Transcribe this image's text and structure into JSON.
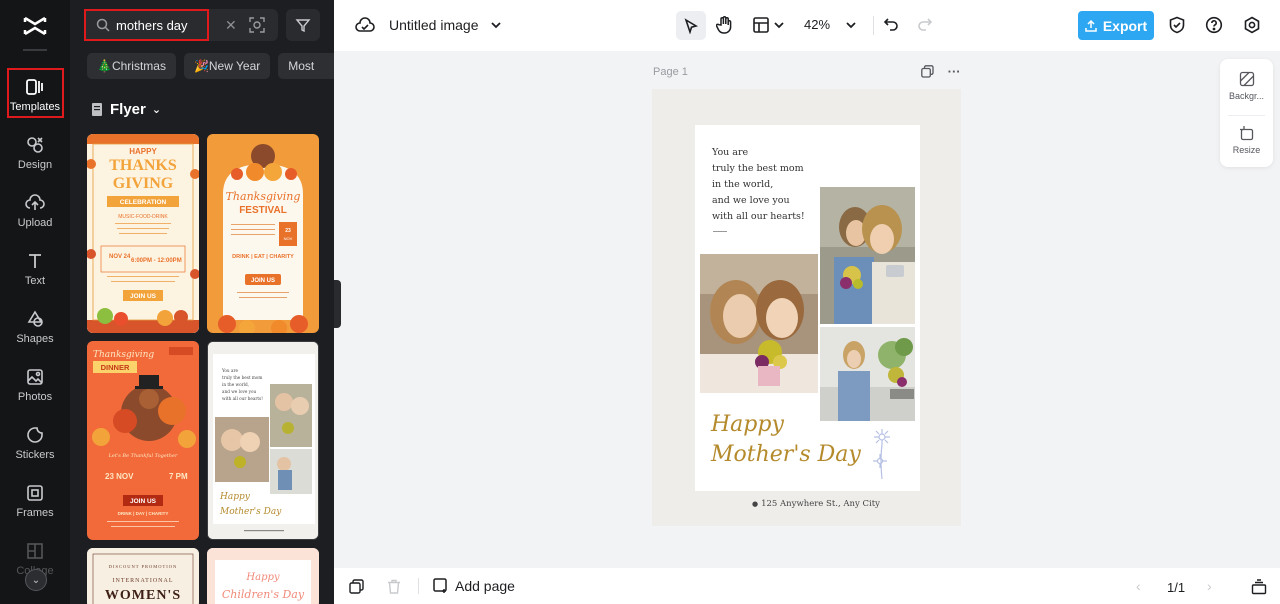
{
  "rail": {
    "items": [
      {
        "label": "Templates",
        "icon": "templates-icon"
      },
      {
        "label": "Design",
        "icon": "design-icon"
      },
      {
        "label": "Upload",
        "icon": "upload-icon"
      },
      {
        "label": "Text",
        "icon": "text-icon"
      },
      {
        "label": "Shapes",
        "icon": "shapes-icon"
      },
      {
        "label": "Photos",
        "icon": "photos-icon"
      },
      {
        "label": "Stickers",
        "icon": "stickers-icon"
      },
      {
        "label": "Frames",
        "icon": "frames-icon"
      },
      {
        "label": "Collage",
        "icon": "collage-icon"
      }
    ]
  },
  "panel": {
    "search": {
      "value": "mothers day"
    },
    "chips": [
      "🎄Christmas",
      "🎉New Year",
      "Most"
    ],
    "section_title": "Flyer",
    "thumbs": {
      "t1": {
        "line1": "HAPPY",
        "line2": "THANKS",
        "line3": "GIVING",
        "banner": "CELEBRATION",
        "sub": "MUSIC-FOOD-DRINK",
        "date": "NOV 24",
        "time": "6:00PM - 12:00PM",
        "cta": "JOIN US"
      },
      "t2": {
        "title": "Thanksgiving",
        "sub": "FESTIVAL",
        "date": "23 NOV 7PM",
        "tags": "DRINK | EAT | CHARITY",
        "cta": "JOIN US"
      },
      "t3": {
        "title": "Thanksgiving",
        "sub": "DINNER",
        "date": "23 NOV",
        "time": "7 PM",
        "cta": "JOIN US",
        "tags": "DRINK | DAY | CHARITY"
      },
      "t4": {
        "l1": "You are",
        "l2": "truly the best mom",
        "l3": "in the world,",
        "l4": "and we love you",
        "l5": "with all our hearts!",
        "hm1": "Happy",
        "hm2": "Mother's Day"
      },
      "t5": {
        "top": "DISCOUNT PROMOTION",
        "l1": "INTERNATIONAL",
        "l2": "WOMEN'S"
      },
      "t6": {
        "l1": "Happy",
        "l2": "Children's Day"
      }
    }
  },
  "topbar": {
    "title": "Untitled image",
    "zoom": "42%",
    "export_label": "Export",
    "accent": "#2ea7f2"
  },
  "canvas": {
    "page_label": "Page 1",
    "card": {
      "text": "You are\ntruly the best mom\nin the world,\nand we love you\nwith all our hearts!",
      "heading1": "Happy",
      "heading2": "Mother's Day",
      "address": "125 Anywhere St., Any City"
    }
  },
  "rpanel": {
    "background": "Backgr...",
    "resize": "Resize"
  },
  "bottombar": {
    "add_page": "Add page",
    "pager": "1/1"
  }
}
